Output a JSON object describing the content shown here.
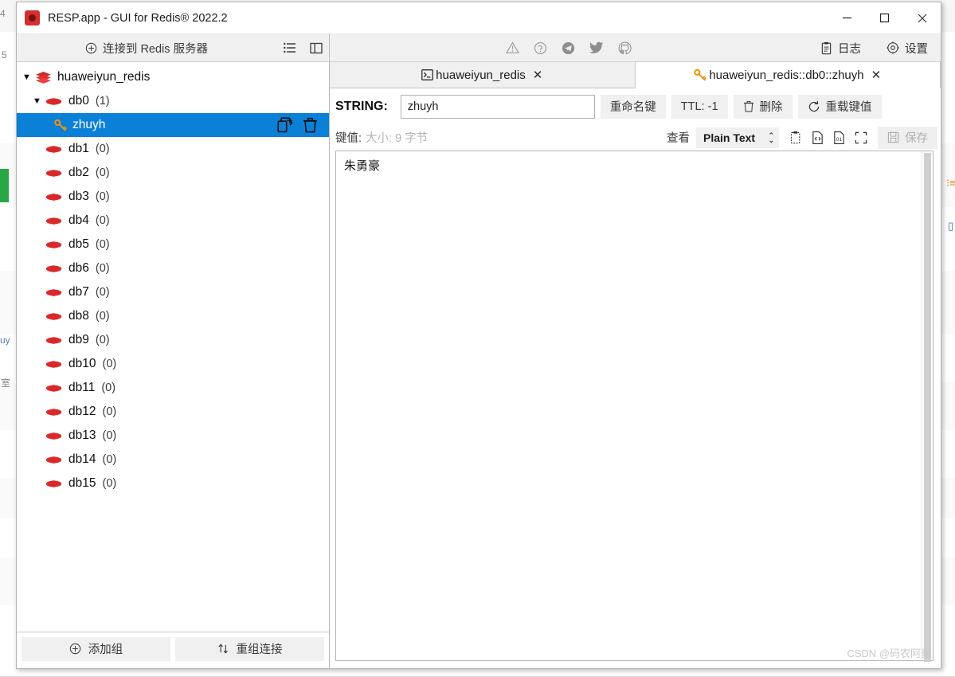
{
  "window": {
    "title": "RESP.app - GUI for Redis® 2022.2",
    "logo_icon": "redis-logo-icon",
    "minimize_label": "—",
    "maximize_label": "▢",
    "close_label": "✕"
  },
  "sidebar": {
    "connect_button": {
      "label": "连接到 Redis 服务器",
      "icon": "plus-circle-icon"
    },
    "list_view_icon": "list-icon",
    "panel_view_icon": "split-panel-icon",
    "tree": [
      {
        "level": 0,
        "label": "huaweiyun_redis",
        "count": "",
        "icon": "stack-icon",
        "caret": "▼",
        "selected": false
      },
      {
        "level": 1,
        "label": "db0",
        "count": "(1)",
        "icon": "database-icon",
        "caret": "▼",
        "selected": false
      },
      {
        "level": 2,
        "label": "zhuyh",
        "count": "",
        "icon": "key-icon",
        "caret": "",
        "selected": true
      },
      {
        "level": 1,
        "label": "db1",
        "count": "(0)",
        "icon": "database-icon",
        "caret": "",
        "selected": false
      },
      {
        "level": 1,
        "label": "db2",
        "count": "(0)",
        "icon": "database-icon",
        "caret": "",
        "selected": false
      },
      {
        "level": 1,
        "label": "db3",
        "count": "(0)",
        "icon": "database-icon",
        "caret": "",
        "selected": false
      },
      {
        "level": 1,
        "label": "db4",
        "count": "(0)",
        "icon": "database-icon",
        "caret": "",
        "selected": false
      },
      {
        "level": 1,
        "label": "db5",
        "count": "(0)",
        "icon": "database-icon",
        "caret": "",
        "selected": false
      },
      {
        "level": 1,
        "label": "db6",
        "count": "(0)",
        "icon": "database-icon",
        "caret": "",
        "selected": false
      },
      {
        "level": 1,
        "label": "db7",
        "count": "(0)",
        "icon": "database-icon",
        "caret": "",
        "selected": false
      },
      {
        "level": 1,
        "label": "db8",
        "count": "(0)",
        "icon": "database-icon",
        "caret": "",
        "selected": false
      },
      {
        "level": 1,
        "label": "db9",
        "count": "(0)",
        "icon": "database-icon",
        "caret": "",
        "selected": false
      },
      {
        "level": 1,
        "label": "db10",
        "count": "(0)",
        "icon": "database-icon",
        "caret": "",
        "selected": false
      },
      {
        "level": 1,
        "label": "db11",
        "count": "(0)",
        "icon": "database-icon",
        "caret": "",
        "selected": false
      },
      {
        "level": 1,
        "label": "db12",
        "count": "(0)",
        "icon": "database-icon",
        "caret": "",
        "selected": false
      },
      {
        "level": 1,
        "label": "db13",
        "count": "(0)",
        "icon": "database-icon",
        "caret": "",
        "selected": false
      },
      {
        "level": 1,
        "label": "db14",
        "count": "(0)",
        "icon": "database-icon",
        "caret": "",
        "selected": false
      },
      {
        "level": 1,
        "label": "db15",
        "count": "(0)",
        "icon": "database-icon",
        "caret": "",
        "selected": false
      }
    ],
    "row_actions": {
      "copy_icon": "copy-key-icon",
      "delete_icon": "trash-icon"
    },
    "footer": {
      "add_group_label": "添加组",
      "add_group_icon": "plus-circle-icon",
      "regroup_label": "重组连接",
      "regroup_icon": "sort-arrows-icon"
    }
  },
  "toolbar": {
    "social": [
      {
        "icon": "warning-triangle-icon"
      },
      {
        "icon": "question-circle-icon"
      },
      {
        "icon": "telegram-icon"
      },
      {
        "icon": "twitter-icon"
      },
      {
        "icon": "github-icon"
      }
    ],
    "log_label": "日志",
    "log_icon": "clipboard-icon",
    "settings_label": "设置",
    "settings_icon": "gear-icon"
  },
  "tabs": [
    {
      "label": "huaweiyun_redis",
      "icon": "console-icon",
      "close": "✕",
      "active": false
    },
    {
      "label": "huaweiyun_redis::db0::zhuyh",
      "icon": "key-icon",
      "close": "✕",
      "active": true
    }
  ],
  "key_editor": {
    "type_label": "STRING:",
    "key_name_value": "zhuyh",
    "key_name_placeholder": "",
    "rename_label": "重命名键",
    "ttl_label": "TTL:  -1",
    "delete_label": "删除",
    "delete_icon": "trash-icon",
    "reload_label": "重载键值",
    "reload_icon": "refresh-icon",
    "value_label": "键值:",
    "value_size": "大小: 9 字节",
    "view_label": "查看",
    "format_value": "Plain Text",
    "format_options": [
      "Plain Text"
    ],
    "value_icons": [
      {
        "icon": "paste-clipboard-icon"
      },
      {
        "icon": "code-file-icon"
      },
      {
        "icon": "binary-file-icon"
      },
      {
        "icon": "fullscreen-icon"
      }
    ],
    "save_label": "保存",
    "save_icon": "floppy-icon",
    "value_content": "朱勇豪"
  },
  "watermark": {
    "text": "CSDN @码农阿豪"
  },
  "colors": {
    "accent_blue": "#0b80d7",
    "redis_red": "#d32f2f",
    "key_orange": "#f0920a",
    "bg_green": "#29a745",
    "toolbar_grey": "#f0f0f0"
  },
  "background": {
    "fragments": [
      {
        "text": "4"
      },
      {
        "text": "5"
      },
      {
        "text": "uy"
      },
      {
        "text": "室"
      }
    ]
  }
}
